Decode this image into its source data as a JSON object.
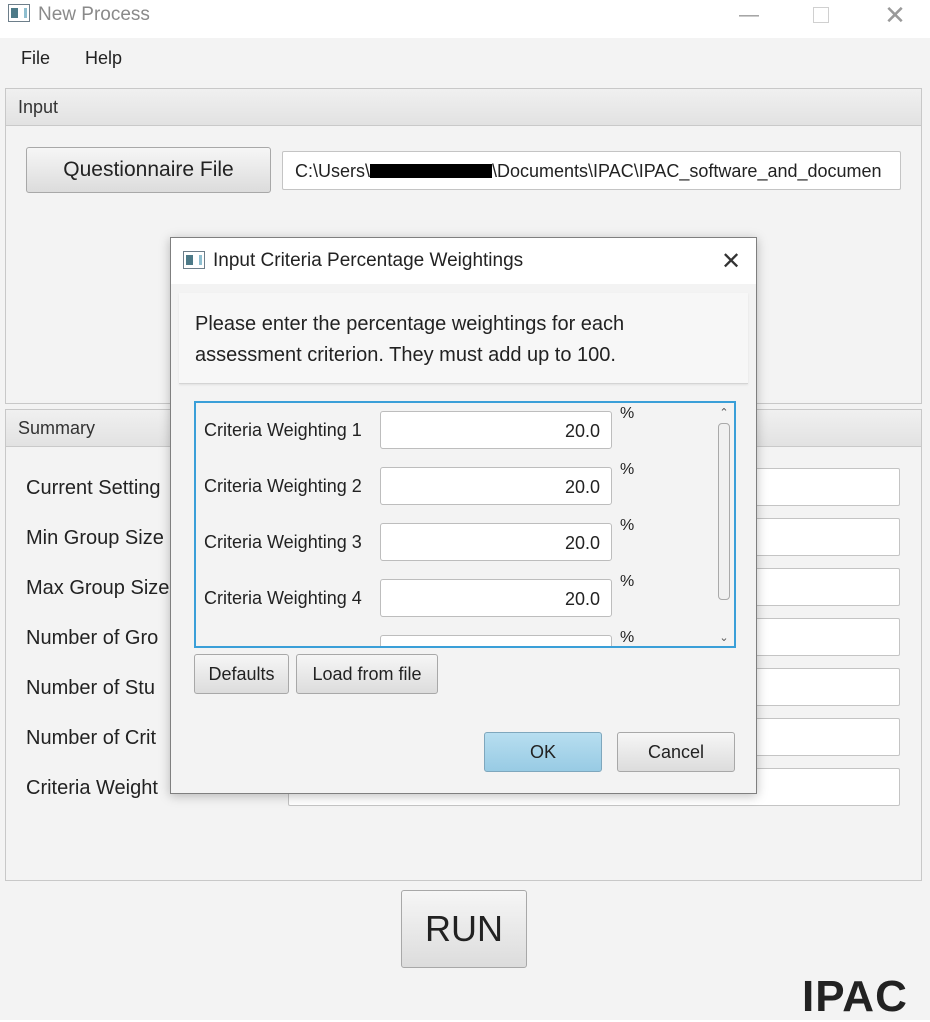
{
  "window": {
    "title": "New Process"
  },
  "menu": {
    "file": "File",
    "help": "Help"
  },
  "input_panel": {
    "title": "Input",
    "questionnaire_button": "Questionnaire File",
    "file_path_prefix": "C:\\Users\\",
    "file_path_suffix": "\\Documents\\IPAC\\IPAC_software_and_documen"
  },
  "summary_panel": {
    "title": "Summary",
    "labels": [
      "Current Setting",
      "Min Group Size",
      "Max Group Size",
      "Number of Gro",
      "Number of Stu",
      "Number of Crit",
      "Criteria Weight"
    ]
  },
  "dialog": {
    "title": "Input Criteria Percentage Weightings",
    "message_line1": "Please enter the percentage weightings for each",
    "message_line2": "assessment criterion. They must add up to 100.",
    "rows": [
      {
        "label": "Criteria Weighting 1",
        "value": "20.0",
        "unit": "%"
      },
      {
        "label": "Criteria Weighting 2",
        "value": "20.0",
        "unit": "%"
      },
      {
        "label": "Criteria Weighting 3",
        "value": "20.0",
        "unit": "%"
      },
      {
        "label": "Criteria Weighting 4",
        "value": "20.0",
        "unit": "%"
      }
    ],
    "partial_unit": "%",
    "defaults_button": "Defaults",
    "load_button": "Load from file",
    "ok_button": "OK",
    "cancel_button": "Cancel"
  },
  "run_button": "RUN",
  "brand": "IPAC",
  "colors": {
    "accent_blue": "#3a9fd8",
    "ok_button": "#a8d4ea"
  }
}
